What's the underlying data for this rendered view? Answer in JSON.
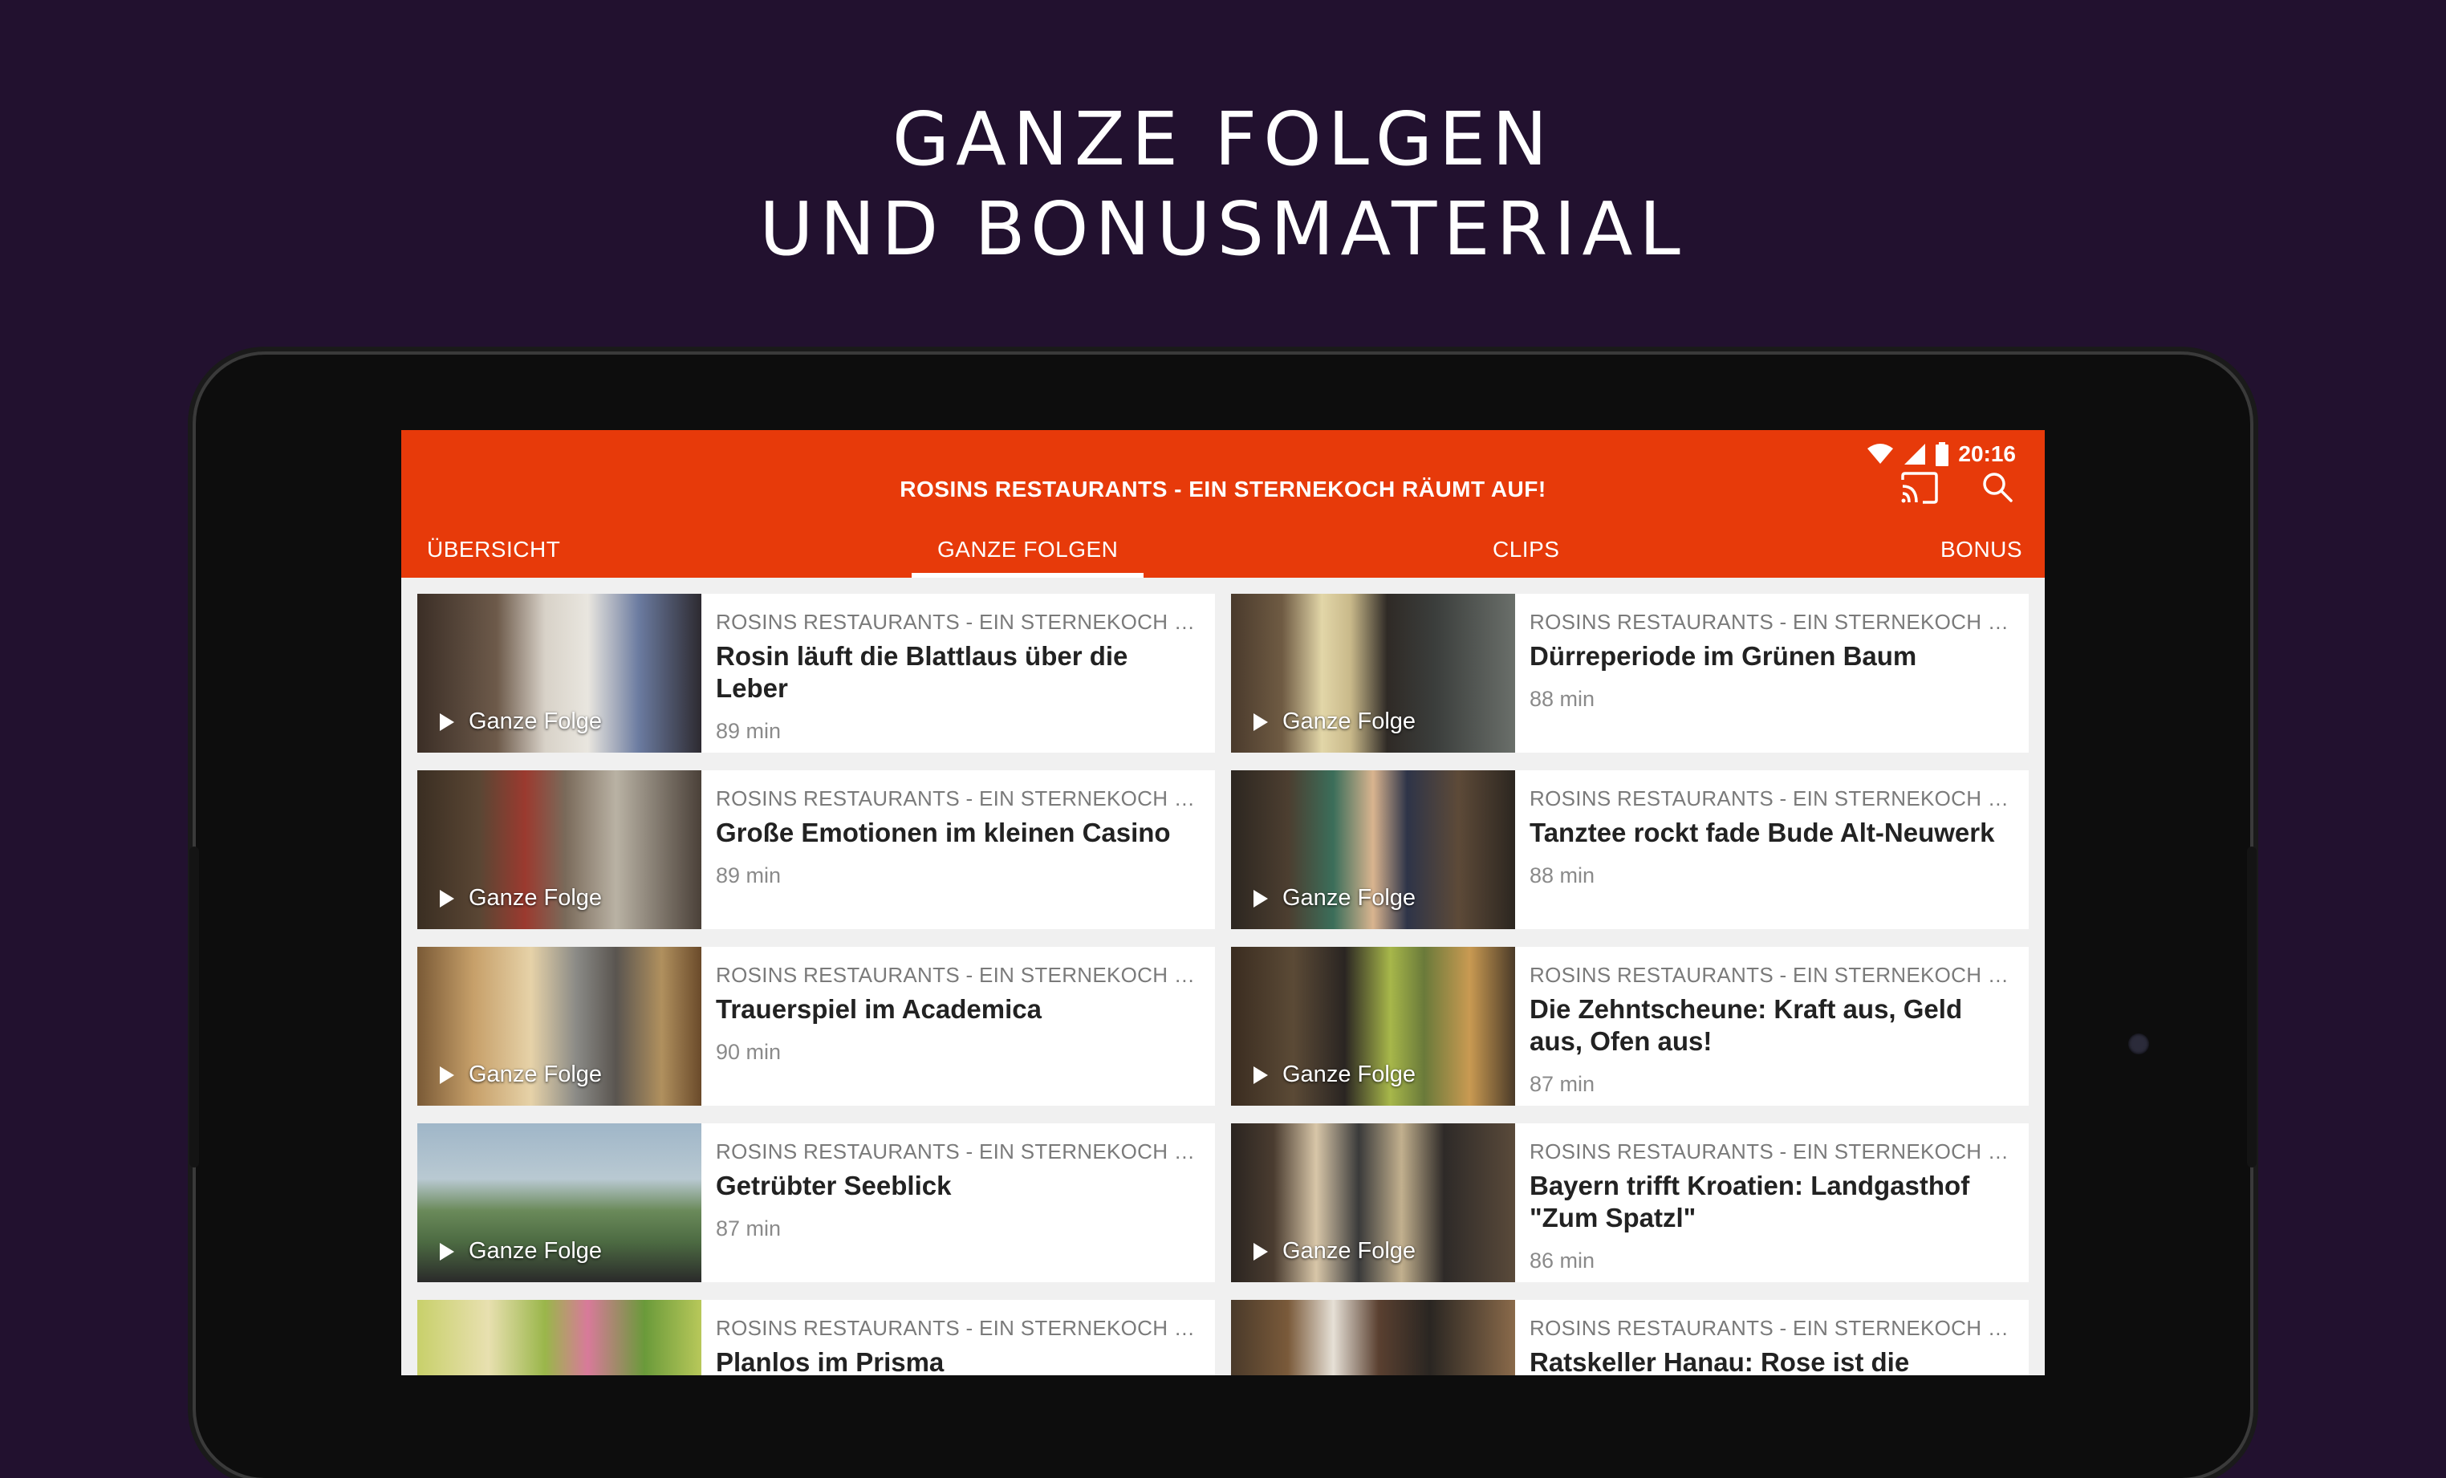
{
  "headline": {
    "line1": "GANZE FOLGEN",
    "line2": "UND BONUSMATERIAL"
  },
  "colors": {
    "background": "#22112f",
    "appbar": "#e73a0a",
    "card": "#ffffff"
  },
  "status": {
    "time": "20:16",
    "icons": [
      "wifi-icon",
      "signal-icon",
      "battery-icon"
    ]
  },
  "appbar": {
    "title": "ROSINS RESTAURANTS - EIN STERNEKOCH RÄUMT AUF!",
    "actions": [
      "cast-icon",
      "search-icon"
    ]
  },
  "tabs": [
    {
      "label": "ÜBERSICHT",
      "active": false
    },
    {
      "label": "GANZE FOLGEN",
      "active": true
    },
    {
      "label": "CLIPS",
      "active": false
    },
    {
      "label": "BONUS",
      "active": false
    }
  ],
  "episodes": [
    {
      "show": "ROSINS RESTAURANTS - EIN STERNEKOCH RÄU...",
      "title": "Rosin läuft die Blattlaus über die Leber",
      "duration": "89 min",
      "badge": "Ganze Folge"
    },
    {
      "show": "ROSINS RESTAURANTS - EIN STERNEKOCH RÄU...",
      "title": "Dürreperiode im Grünen Baum",
      "duration": "88 min",
      "badge": "Ganze Folge"
    },
    {
      "show": "ROSINS RESTAURANTS - EIN STERNEKOCH RÄU...",
      "title": "Große Emotionen im kleinen Casino",
      "duration": "89 min",
      "badge": "Ganze Folge"
    },
    {
      "show": "ROSINS RESTAURANTS - EIN STERNEKOCH RÄU...",
      "title": "Tanztee rockt fade Bude Alt-Neuwerk",
      "duration": "88 min",
      "badge": "Ganze Folge"
    },
    {
      "show": "ROSINS RESTAURANTS - EIN STERNEKOCH RÄU...",
      "title": "Trauerspiel im Academica",
      "duration": "90 min",
      "badge": "Ganze Folge"
    },
    {
      "show": "ROSINS RESTAURANTS - EIN STERNEKOCH RÄU...",
      "title": "Die Zehntscheune: Kraft aus, Geld aus, Ofen aus!",
      "duration": "87 min",
      "badge": "Ganze Folge"
    },
    {
      "show": "ROSINS RESTAURANTS - EIN STERNEKOCH RÄU...",
      "title": "Getrübter Seeblick",
      "duration": "87 min",
      "badge": "Ganze Folge"
    },
    {
      "show": "ROSINS RESTAURANTS - EIN STERNEKOCH RÄU...",
      "title": "Bayern trifft Kroatien: Landgasthof \"Zum Spatzl\"",
      "duration": "86 min",
      "badge": "Ganze Folge"
    },
    {
      "show": "ROSINS RESTAURANTS - EIN STERNEKOCH RÄU...",
      "title": "Planlos im Prisma",
      "duration": "",
      "badge": ""
    },
    {
      "show": "ROSINS RESTAURANTS - EIN STERNEKOCH RÄU...",
      "title": "Ratskeller Hanau: Rose ist die",
      "duration": "",
      "badge": ""
    }
  ]
}
